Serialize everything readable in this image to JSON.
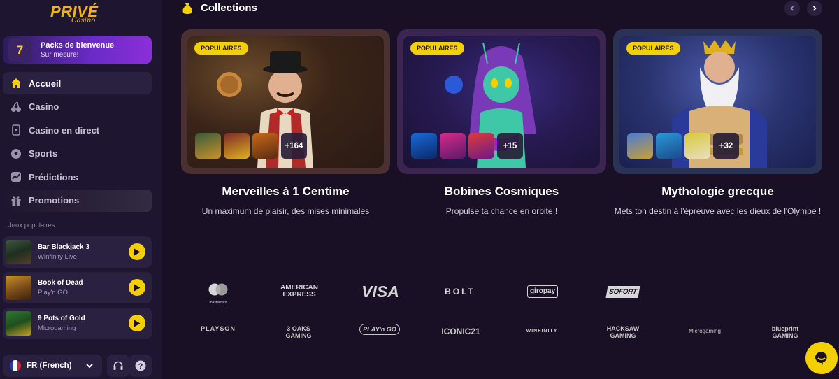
{
  "brand": {
    "name": "PRIVÉ",
    "sub": "Casino"
  },
  "welcome": {
    "title": "Packs de bienvenue",
    "subtitle": "Sur mesure!",
    "icon": "slot-7-icon",
    "icon_text": "7"
  },
  "nav": [
    {
      "label": "Accueil",
      "icon": "home-icon",
      "active": true
    },
    {
      "label": "Casino",
      "icon": "cherries-icon"
    },
    {
      "label": "Casino en direct",
      "icon": "cards-icon"
    },
    {
      "label": "Sports",
      "icon": "soccer-ball-icon"
    },
    {
      "label": "Prédictions",
      "icon": "chart-icon"
    },
    {
      "label": "Promotions",
      "icon": "gift-icon"
    }
  ],
  "popular": {
    "label": "Jeux populaires",
    "games": [
      {
        "name": "Bar Blackjack 3",
        "provider": "Winfinity Live"
      },
      {
        "name": "Book of Dead",
        "provider": "Play'n GO"
      },
      {
        "name": "9 Pots of Gold",
        "provider": "Microgaming"
      }
    ]
  },
  "footer": {
    "language": "FR (French)"
  },
  "collections": {
    "title": "Collections",
    "cards": [
      {
        "badge": "POPULAIRES",
        "more": "+164",
        "title": "Merveilles à 1 Centime",
        "desc": "Un maximum de plaisir, des mises minimales"
      },
      {
        "badge": "POPULAIRES",
        "more": "+15",
        "title": "Bobines Cosmiques",
        "desc": "Propulse ta chance en orbite !"
      },
      {
        "badge": "POPULAIRES",
        "more": "+32",
        "title": "Mythologie grecque",
        "desc": "Mets ton destin à l'épreuve avec les dieux de l'Olympe !"
      }
    ]
  },
  "payments": [
    "mastercard",
    "AMERICAN EXPRESS",
    "VISA",
    "BOLT",
    "giropay",
    "SOFORT"
  ],
  "providers": [
    "PLAYSON",
    "3 OAKS GAMING",
    "PLAY'n GO",
    "ICONIC21",
    "WINFINITY",
    "HACKSAW GAMING",
    "Microgaming",
    "blueprint GAMING"
  ],
  "colors": {
    "accent": "#f5d000",
    "background": "#1a1025",
    "sidebar": "#1e1530",
    "welcome": "#6a2bc7"
  }
}
